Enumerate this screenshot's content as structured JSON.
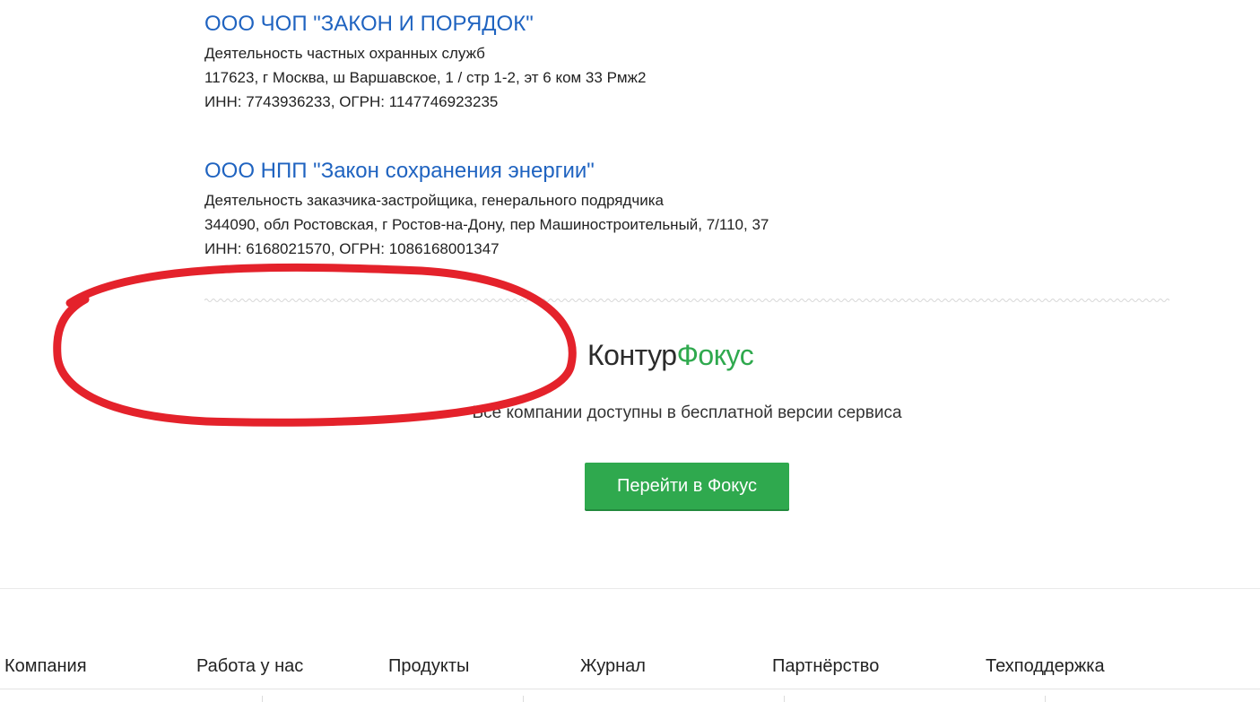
{
  "results": [
    {
      "title": "ООО ЧОП \"ЗАКОН И ПОРЯДОК\"",
      "activity": "Деятельность частных охранных служб",
      "address": "117623, г Москва, ш Варшавское, 1 / стр 1-2, эт 6 ком 33 Рмж2",
      "ids": "ИНН: 7743936233, ОГРН: 1147746923235"
    },
    {
      "title": "ООО НПП \"Закон сохранения энергии\"",
      "activity": "Деятельность заказчика-застройщика, генерального подрядчика",
      "address": "344090, обл Ростовская, г Ростов-на-Дону, пер Машиностроительный, 7/110, 37",
      "ids": "ИНН: 6168021570, ОГРН: 1086168001347"
    }
  ],
  "promo": {
    "brand_part1": "Контур",
    "brand_part2": "Фокус",
    "tagline": "Все компании доступны в бесплатной версии сервиса",
    "cta_label": "Перейти в Фокус"
  },
  "footer": {
    "links": [
      "Компания",
      "Работа у нас",
      "Продукты",
      "Журнал",
      "Партнёрство",
      "Техподдержка"
    ]
  },
  "colors": {
    "link": "#1f63c0",
    "brand_green": "#2fa94e",
    "annotation_red": "#e4222b"
  }
}
